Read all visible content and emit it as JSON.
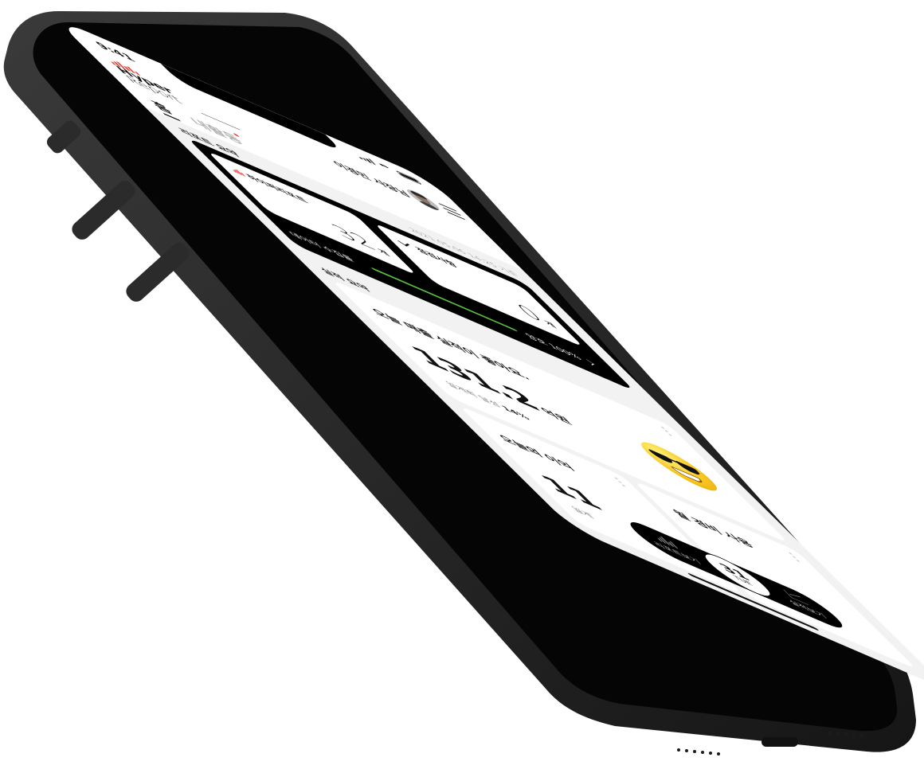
{
  "status_bar": {
    "time": "9:41"
  },
  "header": {
    "logo_line1": "Hyper",
    "logo_line2": "Report",
    "user_name": "이경민 사장님"
  },
  "tabs": [
    {
      "label": "홈",
      "active": true
    },
    {
      "label": "내활동",
      "active": false,
      "has_dot": true
    }
  ],
  "report_summary": {
    "title": "리포트 요약",
    "timestamp": "2021.05.06 14:25 기준",
    "hyper_report": {
      "label": "하이퍼리포트",
      "count": "32",
      "unit": "개"
    },
    "inspection": {
      "label": "점검사항",
      "count": "0",
      "unit": "개"
    },
    "data_collection": {
      "label": "데이터 수집률",
      "status": "양호 100%",
      "progress": 1.0,
      "color": "#56c23d"
    }
  },
  "performance": {
    "title": "실적 요약",
    "sales_card": {
      "headline": "오늘 매출 실적이 좋아요.",
      "amount": "131.2",
      "unit": "억원",
      "target_label": "월계획 달성",
      "target_value": "14%"
    },
    "profit_card": {
      "title": "오늘의 이익",
      "value": "11",
      "sub": "월계"
    },
    "expense_card": {
      "title": "월 경비 사용"
    }
  },
  "bottom_nav": {
    "left_label": "리포트보기",
    "date_day": "31",
    "date_weekday": "TUE",
    "right_label": "실적보기"
  },
  "colors": {
    "accent_red": "#e23b2e",
    "progress_green": "#56c23d"
  }
}
